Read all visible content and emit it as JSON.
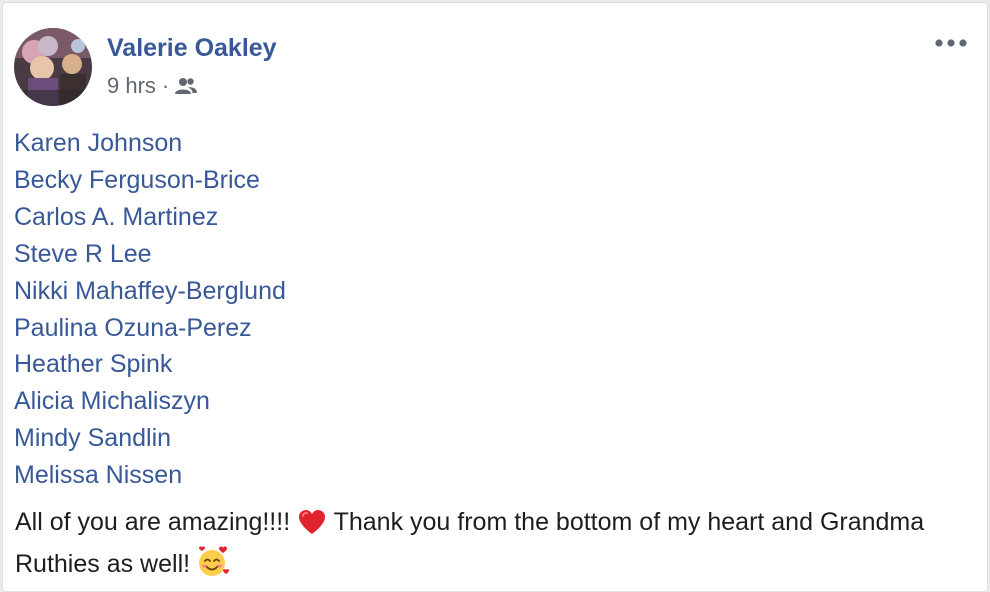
{
  "post": {
    "author": "Valerie Oakley",
    "timestamp": "9 hrs",
    "separator": "·",
    "audience_icon": "friends-icon",
    "more_icon": "ellipsis-icon",
    "tagged_people": [
      "Karen Johnson",
      "Becky Ferguson-Brice",
      "Carlos A. Martinez",
      "Steve R Lee",
      "Nikki Mahaffey-Berglund",
      "Paulina Ozuna-Perez",
      "Heather Spink",
      "Alicia Michaliszyn",
      "Mindy Sandlin",
      "Melissa Nissen"
    ],
    "message_part1": "All of you are amazing!!!! ",
    "message_emoji1": "red-heart-emoji",
    "message_part2": " Thank you from the bottom of my heart and Grandma Ruthies as well! ",
    "message_emoji2": "smiling-face-with-hearts-emoji"
  },
  "colors": {
    "link": "#385898",
    "meta": "#616770",
    "text": "#1c1e21",
    "card_bg": "#ffffff"
  }
}
